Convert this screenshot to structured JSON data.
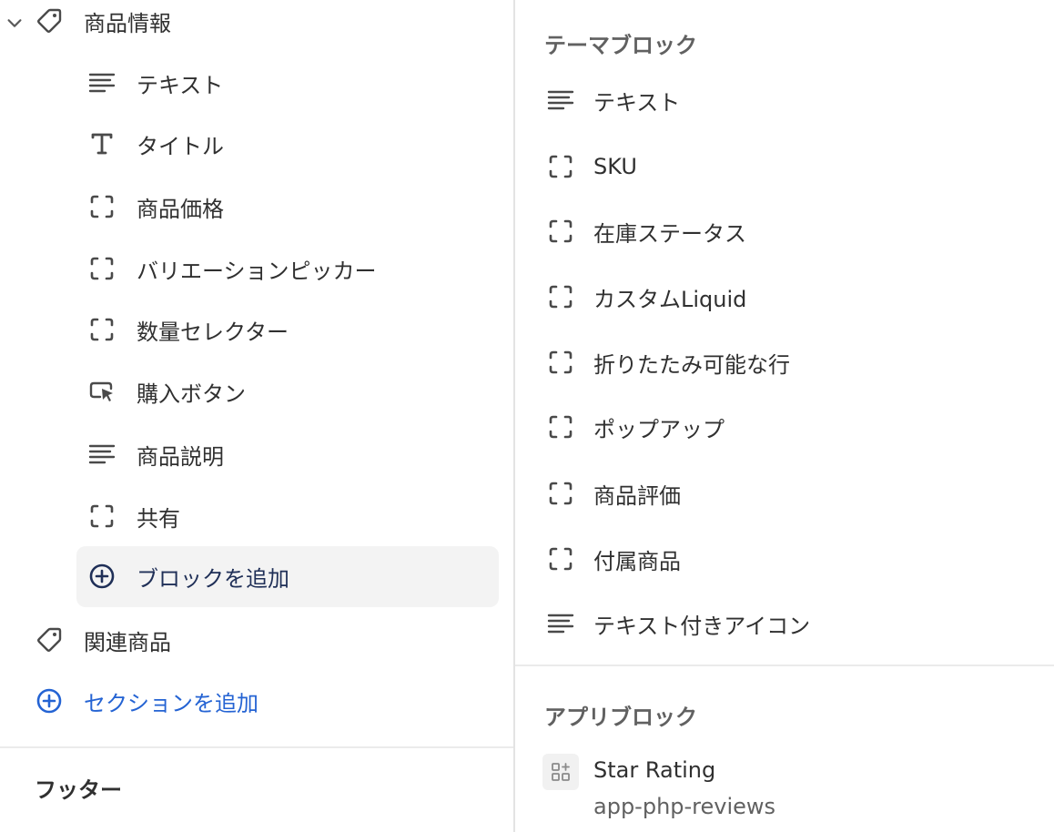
{
  "left_panel": {
    "section": {
      "label": "商品情報",
      "icon": "tag-icon",
      "expanded": true,
      "blocks": [
        {
          "label": "テキスト",
          "icon": "text-lines-icon"
        },
        {
          "label": "タイトル",
          "icon": "title-t-icon"
        },
        {
          "label": "商品価格",
          "icon": "dashed-block-icon"
        },
        {
          "label": "バリエーションピッカー",
          "icon": "dashed-block-icon"
        },
        {
          "label": "数量セレクター",
          "icon": "dashed-block-icon"
        },
        {
          "label": "購入ボタン",
          "icon": "button-pointer-icon"
        },
        {
          "label": "商品説明",
          "icon": "text-lines-icon"
        },
        {
          "label": "共有",
          "icon": "dashed-block-icon"
        }
      ],
      "add_block_label": "ブロックを追加"
    },
    "related_section": {
      "label": "関連商品",
      "icon": "tag-icon"
    },
    "add_section_label": "セクションを追加",
    "footer_title": "フッター"
  },
  "right_panel": {
    "theme_blocks_heading": "テーマブロック",
    "theme_blocks": [
      {
        "label": "テキスト",
        "icon": "text-lines-icon"
      },
      {
        "label": "SKU",
        "icon": "dashed-block-icon"
      },
      {
        "label": "在庫ステータス",
        "icon": "dashed-block-icon"
      },
      {
        "label": "カスタムLiquid",
        "icon": "dashed-block-icon"
      },
      {
        "label": "折りたたみ可能な行",
        "icon": "dashed-block-icon"
      },
      {
        "label": "ポップアップ",
        "icon": "dashed-block-icon"
      },
      {
        "label": "商品評価",
        "icon": "dashed-block-icon"
      },
      {
        "label": "付属商品",
        "icon": "dashed-block-icon"
      },
      {
        "label": "テキスト付きアイコン",
        "icon": "text-lines-icon"
      }
    ],
    "app_blocks_heading": "アプリブロック",
    "app_blocks": [
      {
        "name": "Star Rating",
        "app": "app-php-reviews",
        "icon": "app-block-icon"
      }
    ]
  },
  "colors": {
    "link_blue": "#2463d3",
    "dark_navy": "#1f2f57",
    "text": "#303030",
    "muted": "#616161"
  }
}
